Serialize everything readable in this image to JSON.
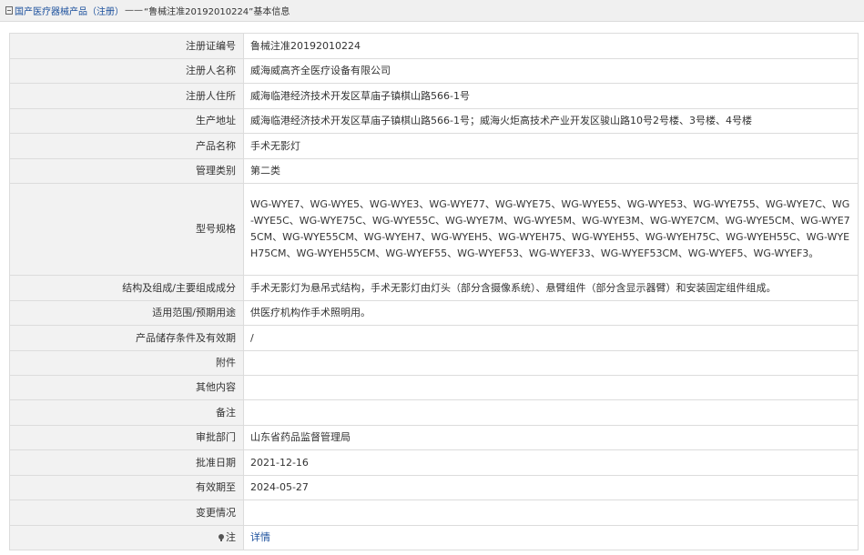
{
  "breadcrumb": {
    "section": "国产医疗器械产品（注册）",
    "separator": "——",
    "current": "“鲁械注准20192010224”基本信息"
  },
  "rows": [
    {
      "label": "注册证编号",
      "value": "鲁械注准20192010224"
    },
    {
      "label": "注册人名称",
      "value": "威海威高齐全医疗设备有限公司"
    },
    {
      "label": "注册人住所",
      "value": "威海临港经济技术开发区草庙子镇棋山路566-1号"
    },
    {
      "label": "生产地址",
      "value": "威海临港经济技术开发区草庙子镇棋山路566-1号；威海火炬高技术产业开发区骏山路10号2号楼、3号楼、4号楼"
    },
    {
      "label": "产品名称",
      "value": "手术无影灯"
    },
    {
      "label": "管理类别",
      "value": "第二类"
    },
    {
      "label": "型号规格",
      "value": "WG-WYE7、WG-WYE5、WG-WYE3、WG-WYE77、WG-WYE75、WG-WYE55、WG-WYE53、WG-WYE755、WG-WYE7C、WG-WYE5C、WG-WYE75C、WG-WYE55C、WG-WYE7M、WG-WYE5M、WG-WYE3M、WG-WYE7CM、WG-WYE5CM、WG-WYE75CM、WG-WYE55CM、WG-WYEH7、WG-WYEH5、WG-WYEH75、WG-WYEH55、WG-WYEH75C、WG-WYEH55C、WG-WYEH75CM、WG-WYEH55CM、WG-WYEF55、WG-WYEF53、WG-WYEF33、WG-WYEF53CM、WG-WYEF5、WG-WYEF3。"
    },
    {
      "label": "结构及组成/主要组成成分",
      "value": "手术无影灯为悬吊式结构，手术无影灯由灯头（部分含摄像系统）、悬臂组件（部分含显示器臂）和安装固定组件组成。"
    },
    {
      "label": "适用范围/预期用途",
      "value": "供医疗机构作手术照明用。"
    },
    {
      "label": "产品储存条件及有效期",
      "value": "/"
    },
    {
      "label": "附件",
      "value": ""
    },
    {
      "label": "其他内容",
      "value": ""
    },
    {
      "label": "备注",
      "value": ""
    },
    {
      "label": "审批部门",
      "value": "山东省药品监督管理局"
    },
    {
      "label": "批准日期",
      "value": "2021-12-16"
    },
    {
      "label": "有效期至",
      "value": "2024-05-27"
    },
    {
      "label": "变更情况",
      "value": ""
    }
  ],
  "note_row": {
    "label": "注",
    "link_text": "详情",
    "icon": "pin-icon"
  }
}
